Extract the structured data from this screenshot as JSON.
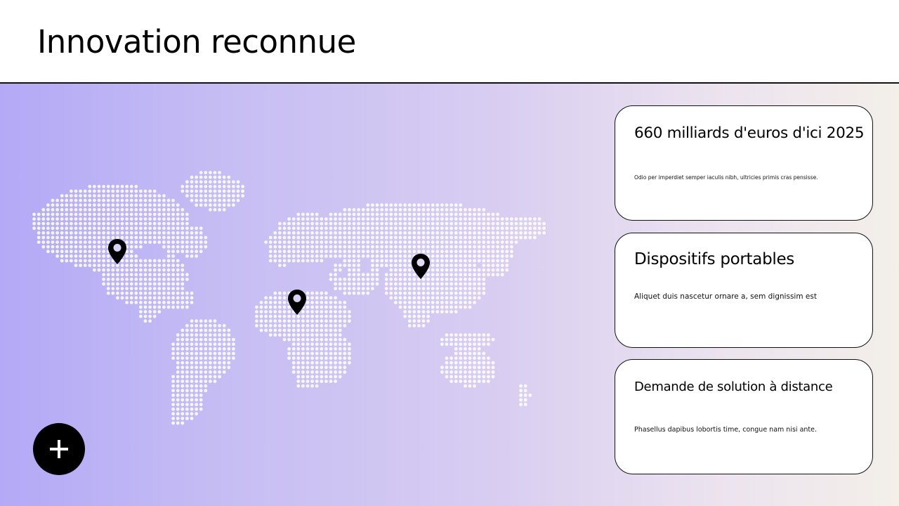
{
  "page": {
    "title": "Innovation reconnue"
  },
  "map": {
    "pins": [
      {
        "icon": "map-pin-icon"
      },
      {
        "icon": "map-pin-icon"
      },
      {
        "icon": "map-pin-icon"
      }
    ]
  },
  "cards": [
    {
      "title": "660 milliards d'euros d'ici 2025",
      "text": "Odio per imperdiet semper iaculis nibh, ultricies primis cras pensisse."
    },
    {
      "title": "Dispositifs portables",
      "text": "Aliquet duis nascetur ornare a, sem dignissim est"
    },
    {
      "title": "Demande de solution à distance",
      "text": "Phasellus dapibus lobortis time, congue nam nisi ante."
    }
  ],
  "add_button": {
    "icon": "plus-icon"
  },
  "colors": {
    "gradient_start": "#b3a9f6",
    "gradient_end": "#f3efe9",
    "dots": "#ffffff",
    "pin": "#000000"
  }
}
